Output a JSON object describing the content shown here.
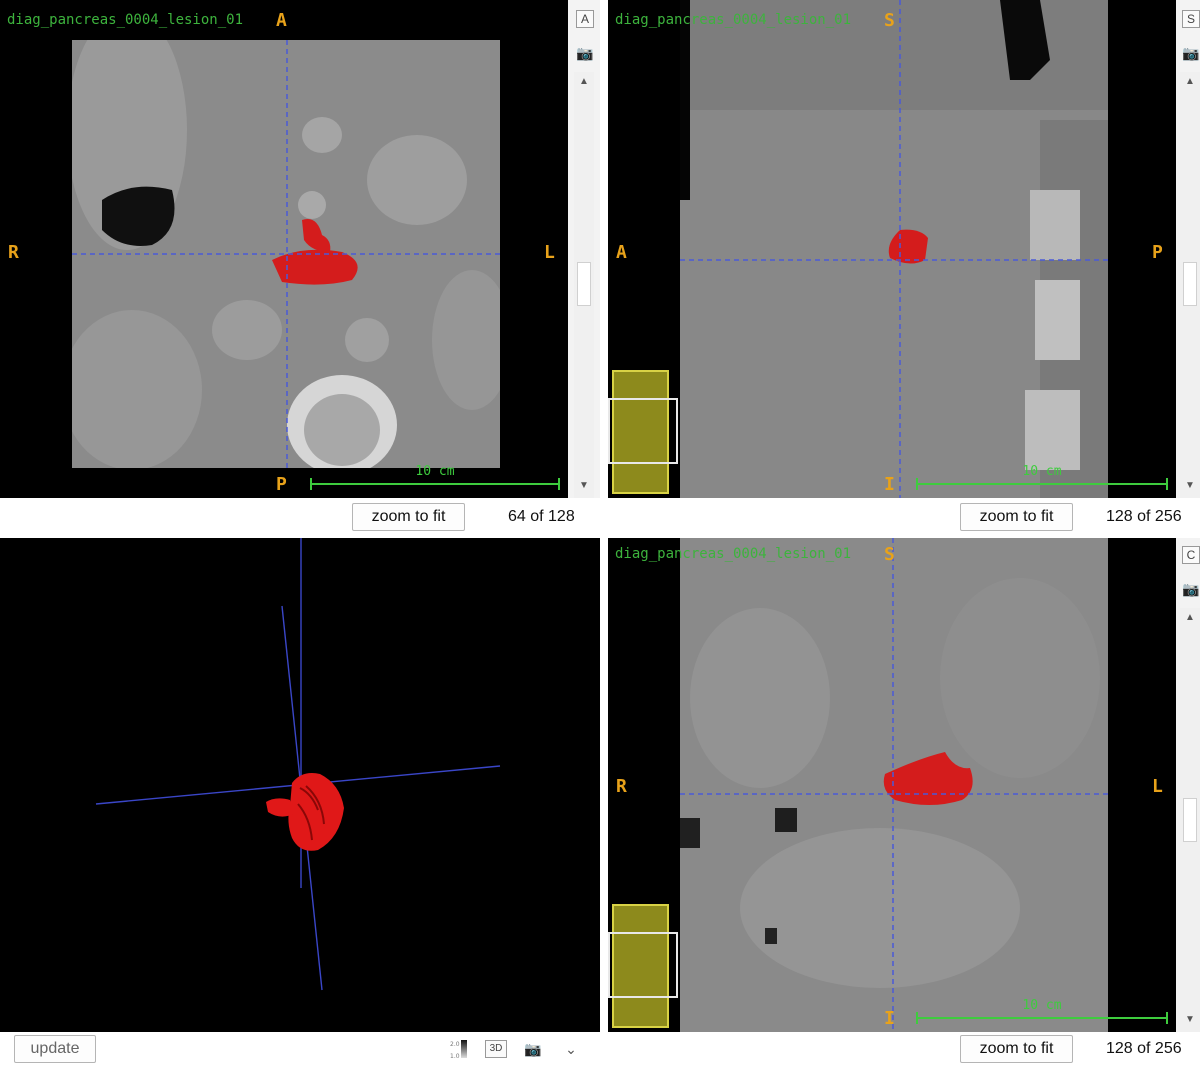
{
  "views": {
    "axial": {
      "series_name": "diag_pancreas_0004_lesion_01",
      "orient_top": "A",
      "orient_left": "R",
      "orient_right": "L",
      "orient_bottom": "P",
      "scale_label": "10 cm",
      "zoom_label": "zoom to fit",
      "slice_counter": "64 of 128",
      "mode_button": "A"
    },
    "sagittal": {
      "series_name": "diag_pancreas_0004_lesion_01",
      "orient_top": "S",
      "orient_left": "A",
      "orient_right": "P",
      "orient_bottom": "I",
      "scale_label": "10 cm",
      "zoom_label": "zoom to fit",
      "slice_counter": "128 of 256",
      "mode_button": "S"
    },
    "coronal": {
      "series_name": "diag_pancreas_0004_lesion_01",
      "orient_top": "S",
      "orient_left": "R",
      "orient_right": "L",
      "orient_bottom": "I",
      "scale_label": "10 cm",
      "zoom_label": "zoom to fit",
      "slice_counter": "128 of 256",
      "mode_button": "C"
    },
    "render3d": {
      "update_label": "update",
      "mode_3d_label": "3D",
      "icons": [
        "gradient-scale-icon",
        "3d-toggle-icon",
        "camera-icon",
        "chevron-down-icon"
      ]
    }
  },
  "colors": {
    "lesion": "#e01818",
    "crosshair": "#4a5ad8",
    "orientation": "#e8a21a",
    "series_label": "#3db33d",
    "scalebar": "#3ecc3e",
    "thumbnail_frame": "#d8d245"
  }
}
